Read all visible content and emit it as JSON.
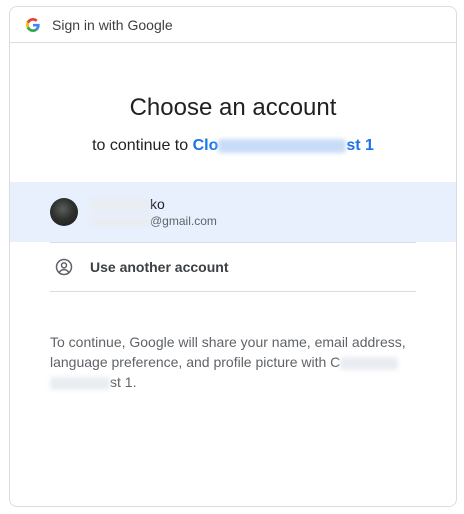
{
  "header": {
    "title": "Sign in with Google",
    "logo_icon": "google-g-icon"
  },
  "main": {
    "title": "Choose an account",
    "subtitle_prefix": "to continue to ",
    "app_name_start": "Clo",
    "app_name_end": "st 1"
  },
  "account": {
    "name_suffix": "ko",
    "email_suffix": "@gmail.com",
    "avatar_icon": "avatar-photo"
  },
  "another": {
    "label": "Use another account",
    "icon": "person-circle-icon"
  },
  "disclaimer": {
    "part1": "To continue, Google will share your name, email address, language preference, and profile picture with C",
    "part2": "st 1."
  },
  "colors": {
    "accent": "#1a73e8",
    "selected_row": "#e8f0fe",
    "border": "#dadce0"
  }
}
